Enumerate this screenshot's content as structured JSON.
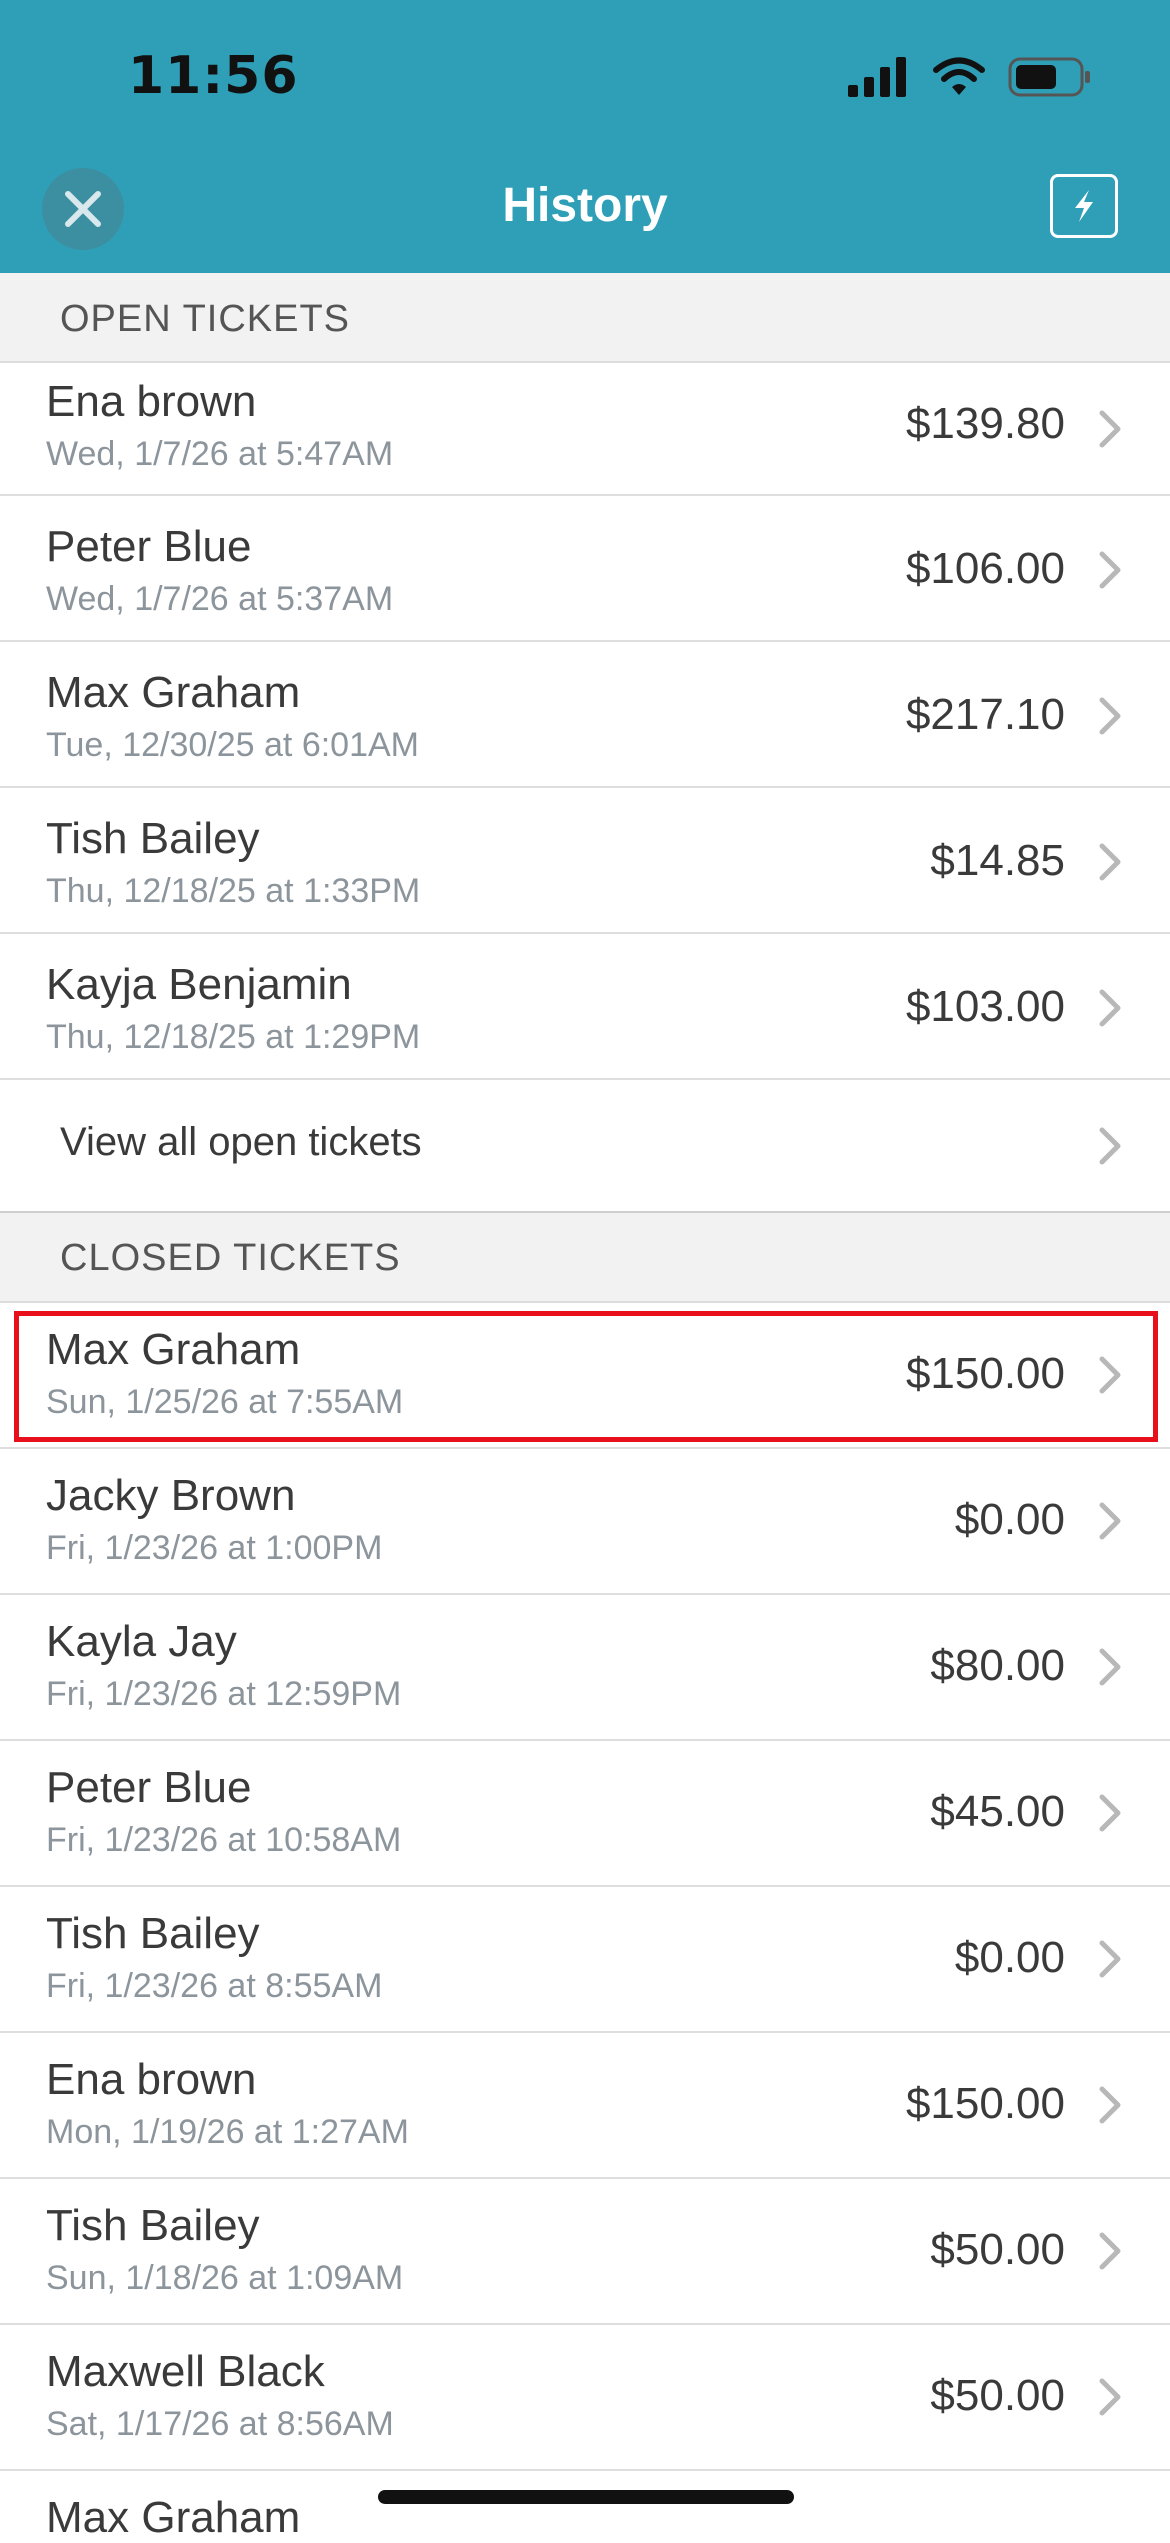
{
  "status": {
    "time": "11:56"
  },
  "header": {
    "title": "History"
  },
  "open_section": {
    "label": "OPEN TICKETS"
  },
  "open_tickets": [
    {
      "name": "Ena brown",
      "date": "Wed, 1/7/26 at 5:47AM",
      "amount": "$139.80"
    },
    {
      "name": "Peter Blue",
      "date": "Wed, 1/7/26 at 5:37AM",
      "amount": "$106.00"
    },
    {
      "name": "Max Graham",
      "date": "Tue, 12/30/25 at 6:01AM",
      "amount": "$217.10"
    },
    {
      "name": "Tish Bailey",
      "date": "Thu, 12/18/25 at 1:33PM",
      "amount": "$14.85"
    },
    {
      "name": "Kayja Benjamin",
      "date": "Thu, 12/18/25 at 1:29PM",
      "amount": "$103.00"
    }
  ],
  "view_all": {
    "label": "View all open tickets"
  },
  "closed_section": {
    "label": "CLOSED TICKETS"
  },
  "closed_tickets": [
    {
      "name": "Max Graham",
      "date": "Sun, 1/25/26 at 7:55AM",
      "amount": "$150.00"
    },
    {
      "name": "Jacky Brown",
      "date": "Fri, 1/23/26 at 1:00PM",
      "amount": "$0.00"
    },
    {
      "name": "Kayla Jay",
      "date": "Fri, 1/23/26 at 12:59PM",
      "amount": "$80.00"
    },
    {
      "name": "Peter Blue",
      "date": "Fri, 1/23/26 at 10:58AM",
      "amount": "$45.00"
    },
    {
      "name": "Tish Bailey",
      "date": "Fri, 1/23/26 at 8:55AM",
      "amount": "$0.00"
    },
    {
      "name": "Ena brown",
      "date": "Mon, 1/19/26 at 1:27AM",
      "amount": "$150.00"
    },
    {
      "name": "Tish Bailey",
      "date": "Sun, 1/18/26 at 1:09AM",
      "amount": "$50.00"
    },
    {
      "name": "Maxwell Black",
      "date": "Sat, 1/17/26 at 8:56AM",
      "amount": "$50.00"
    },
    {
      "name": "Max Graham",
      "date": "",
      "amount": ""
    }
  ],
  "colors": {
    "header": "#2f9fb7",
    "highlight": "#e8101c"
  },
  "icons": [
    "close-icon",
    "flash-icon",
    "chevron-right-icon",
    "signal-icon",
    "wifi-icon",
    "battery-icon"
  ]
}
